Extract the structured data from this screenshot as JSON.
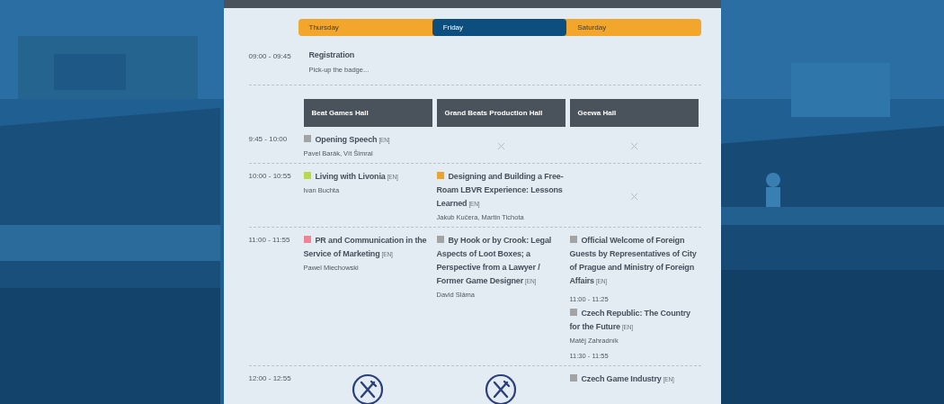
{
  "days": [
    {
      "label": "Thursday",
      "selected": false
    },
    {
      "label": "Friday",
      "selected": true
    },
    {
      "label": "Saturday",
      "selected": false
    }
  ],
  "registration": {
    "time": "09:00 - 09:45",
    "title": "Registration",
    "description": "Pick-up the badge..."
  },
  "halls": [
    "Beat Games Hall",
    "Grand Beats Production Hall",
    "Geewa Hall"
  ],
  "rows": [
    {
      "time": "9:45 - 10:00",
      "cells": [
        {
          "kind": "talks",
          "talks": [
            {
              "title": "Opening Speech",
              "lang": "[EN]",
              "speakers": "Pavel Barák, Vít Šimral",
              "color": "#a3a3a3"
            }
          ]
        },
        {
          "kind": "empty"
        },
        {
          "kind": "empty"
        }
      ]
    },
    {
      "time": "10:00 - 10:55",
      "cells": [
        {
          "kind": "talks",
          "talks": [
            {
              "title": "Living with Livonia",
              "lang": "[EN]",
              "speakers": "Ivan Buchta",
              "color": "#b8d94c"
            }
          ]
        },
        {
          "kind": "talks",
          "talks": [
            {
              "title": "Designing and Building a Free-Roam LBVR Experience: Lessons Learned",
              "lang": "[EN]",
              "speakers": "Jakub Kučera, Martin Tichota",
              "color": "#e9a42e"
            }
          ]
        },
        {
          "kind": "empty"
        }
      ]
    },
    {
      "time": "11:00 - 11:55",
      "cells": [
        {
          "kind": "talks",
          "talks": [
            {
              "title": "PR and Communication in the Service of Marketing",
              "lang": "[EN]",
              "speakers": "Pawel Miechowski",
              "color": "#f08493"
            }
          ]
        },
        {
          "kind": "talks",
          "talks": [
            {
              "title": "By Hook or by Crook: Legal Aspects of Loot Boxes; a Perspective from a Lawyer / Former Game Designer",
              "lang": "[EN]",
              "speakers": "David Sláma",
              "color": "#a3a3a3"
            }
          ]
        },
        {
          "kind": "talks",
          "talks": [
            {
              "title": "Official Welcome of Foreign Guests by Representatives of City of Prague and Ministry of Foreign Affairs",
              "lang": "[EN]",
              "color": "#a3a3a3",
              "time": "11:00 - 11:25"
            },
            {
              "title": "Czech Republic: The Country for the Future",
              "lang": "[EN]",
              "speakers": "Matěj Zahradník",
              "color": "#a3a3a3",
              "time": "11:30 - 11:55"
            }
          ]
        }
      ]
    },
    {
      "time": "12:00 - 12:55",
      "cells": [
        {
          "kind": "meal"
        },
        {
          "kind": "meal"
        },
        {
          "kind": "talks",
          "talks": [
            {
              "title": "Czech Game Industry",
              "lang": "[EN]",
              "color": "#a3a3a3"
            }
          ]
        }
      ]
    }
  ]
}
